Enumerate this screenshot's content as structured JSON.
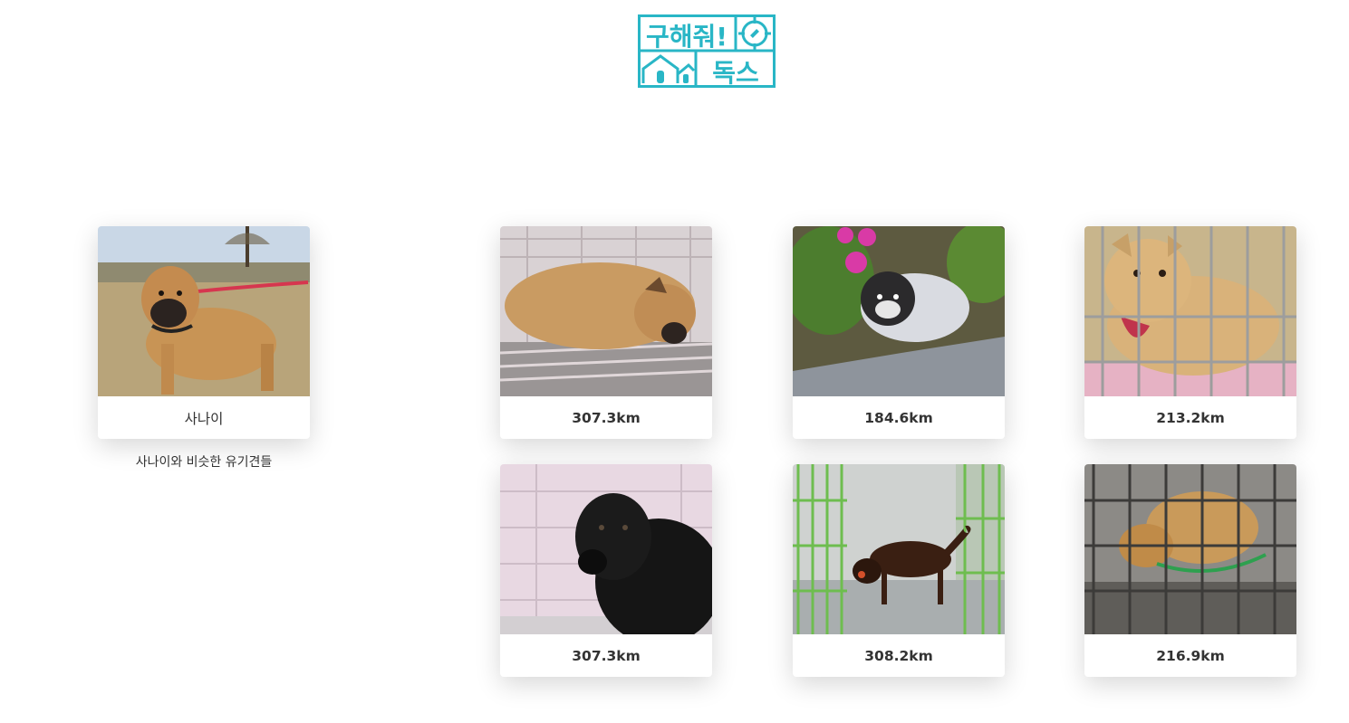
{
  "logo": {
    "line1": "구해줘!",
    "line2": "독스",
    "color": "#29b6c6"
  },
  "selected_dog": {
    "name": "사나이",
    "similar_caption": "사나이와 비슷한 유기견들"
  },
  "results": [
    {
      "distance": "307.3km"
    },
    {
      "distance": "184.6km"
    },
    {
      "distance": "213.2km"
    },
    {
      "distance": "307.3km"
    },
    {
      "distance": "308.2km"
    },
    {
      "distance": "216.9km"
    }
  ]
}
